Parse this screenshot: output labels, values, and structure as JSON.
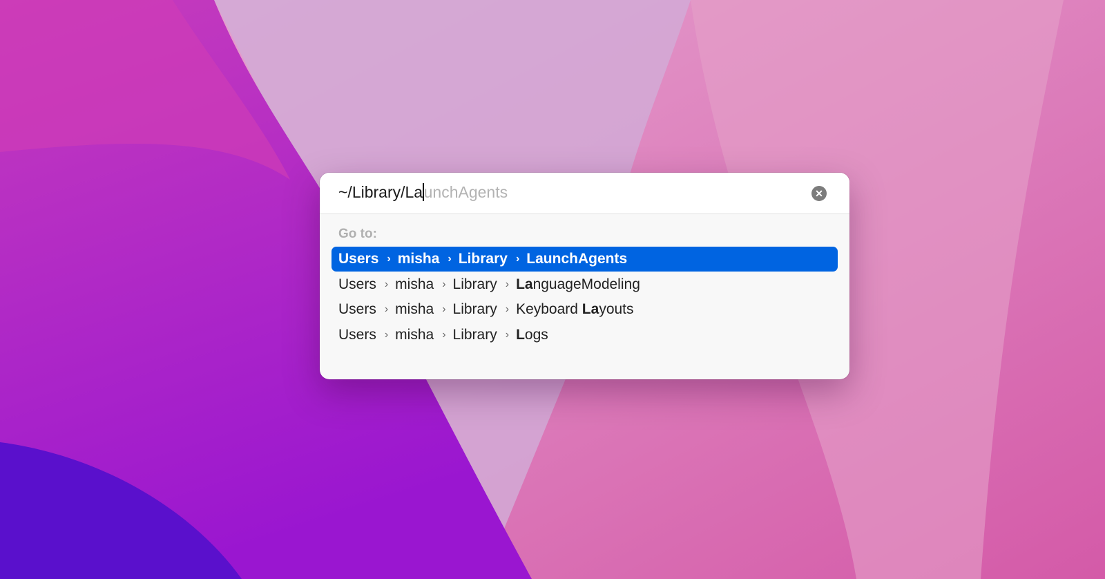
{
  "colors": {
    "accent": "#0064e1",
    "clear_button": "#7c7c7c"
  },
  "field": {
    "typed": "~/Library/La",
    "suggestion": "unchAgents",
    "clear_icon": "xmark-circle-fill"
  },
  "goto_label": "Go to:",
  "separator": "›",
  "results": [
    {
      "parts": [
        "Users",
        "misha",
        "Library"
      ],
      "last_bold": "La",
      "last_rest": "unchAgents",
      "last_pre": "",
      "selected": true
    },
    {
      "parts": [
        "Users",
        "misha",
        "Library"
      ],
      "last_bold": "La",
      "last_rest": "nguageModeling",
      "last_pre": "",
      "selected": false
    },
    {
      "parts": [
        "Users",
        "misha",
        "Library"
      ],
      "last_pre": "Keyboard ",
      "last_bold": "La",
      "last_rest": "youts",
      "selected": false
    },
    {
      "parts": [
        "Users",
        "misha",
        "Library"
      ],
      "last_bold": "L",
      "last_rest": "ogs",
      "last_pre": "",
      "selected": false
    }
  ]
}
